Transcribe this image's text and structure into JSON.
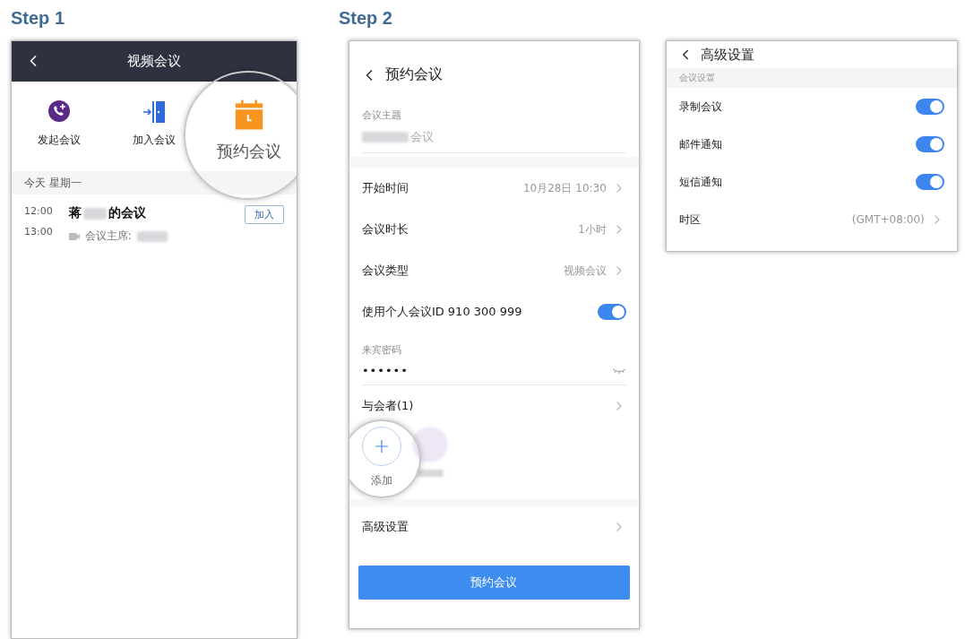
{
  "steps": [
    {
      "label": "Step 1"
    },
    {
      "label": "Step 2"
    }
  ],
  "screen1": {
    "title": "视频会议",
    "actions": [
      {
        "label": "发起会议",
        "kind": "start",
        "highlighted": false
      },
      {
        "label": "加入会议",
        "kind": "join",
        "highlighted": false
      },
      {
        "label": "预约会议",
        "kind": "schedule",
        "highlighted": true
      }
    ],
    "day": "今天 星期一",
    "meetings": [
      {
        "start": "12:00",
        "end": "13:00",
        "title_prefix": "蒋",
        "title_suffix": "的会议",
        "host_label": "会议主席:",
        "join": "加入"
      }
    ]
  },
  "screen2": {
    "title": "预约会议",
    "subject": {
      "label": "会议主题",
      "value_suffix": "会议"
    },
    "rows": [
      {
        "kind": "link",
        "label": "开始时间",
        "value": "10月28日 10:30"
      },
      {
        "kind": "link",
        "label": "会议时长",
        "value": "1小时"
      },
      {
        "kind": "link",
        "label": "会议类型",
        "value": "视频会议"
      },
      {
        "kind": "toggle",
        "label": "使用个人会议ID 910 300 999",
        "on": true
      }
    ],
    "password": {
      "label": "来宾密码",
      "value": "••••••"
    },
    "attendees": {
      "label": "与会者(1)",
      "add": "添加"
    },
    "advanced": "高级设置",
    "submit": "预约会议"
  },
  "screen3": {
    "title": "高级设置",
    "section": "会议设置",
    "rows": [
      {
        "kind": "toggle",
        "label": "录制会议",
        "on": true
      },
      {
        "kind": "toggle",
        "label": "邮件通知",
        "on": true
      },
      {
        "kind": "toggle",
        "label": "短信通知",
        "on": true
      },
      {
        "kind": "link",
        "label": "时区",
        "value": "(GMT+08:00)"
      }
    ]
  }
}
